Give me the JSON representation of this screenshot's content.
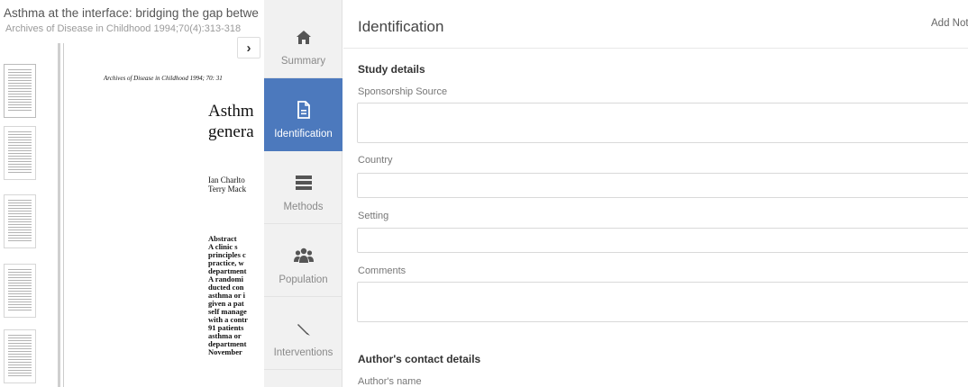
{
  "document": {
    "title": "Asthma at the interface: bridging the gap betwe",
    "citation": "Archives of Disease in Childhood 1994;70(4):313-318",
    "page": {
      "running_header": "Archives of Disease in Childhood 1994; 70: 31",
      "heading_line1": "Asthm",
      "heading_line2": "genera",
      "authors_line1": "Ian Charlto",
      "authors_line2": "Terry Mack",
      "abstract_title": "Abstract",
      "abstract_text": "A clinic s\nprinciples c\npractice, w\ndepartment\nA randomi\nducted con\nasthma or i\ngiven a pat\nself manage\nwith a contr\n91 patients\nasthma or \ndepartment\nNovember"
    }
  },
  "expand_icon": "chevron-right-icon",
  "nav": {
    "items": [
      {
        "label": "Summary",
        "icon": "home-icon",
        "active": false
      },
      {
        "label": "Identification",
        "icon": "document-icon",
        "active": true
      },
      {
        "label": "Methods",
        "icon": "list-icon",
        "active": false
      },
      {
        "label": "Population",
        "icon": "users-icon",
        "active": false
      },
      {
        "label": "Interventions",
        "icon": "pencil-icon",
        "active": false
      }
    ]
  },
  "panel": {
    "title": "Identification",
    "add_note": "Add Not",
    "study_details": {
      "heading": "Study details",
      "fields": [
        {
          "label": "Sponsorship Source",
          "value": ""
        },
        {
          "label": "Country",
          "value": ""
        },
        {
          "label": "Setting",
          "value": ""
        },
        {
          "label": "Comments",
          "value": ""
        }
      ]
    },
    "author_contact": {
      "heading": "Author's contact details",
      "fields": [
        {
          "label": "Author's name",
          "value": ""
        }
      ]
    }
  },
  "colors": {
    "nav_active_bg": "#4c79bd",
    "nav_bg": "#f1f1f1"
  }
}
